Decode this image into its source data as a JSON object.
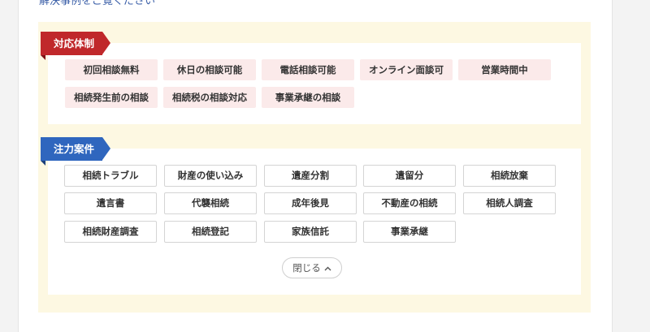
{
  "top_text": "解決事例をご覧ください",
  "support": {
    "title": "対応体制",
    "tags": [
      "初回相談無料",
      "休日の相談可能",
      "電話相談可能",
      "オンライン面談可",
      "営業時間中",
      "相続発生前の相談",
      "相続税の相談対応",
      "事業承継の相談"
    ]
  },
  "focus": {
    "title": "注力案件",
    "tags": [
      "相続トラブル",
      "財産の使い込み",
      "遺産分割",
      "遺留分",
      "相続放棄",
      "遺言書",
      "代襲相続",
      "成年後見",
      "不動産の相続",
      "相続人調査",
      "相続財産調査",
      "相続登記",
      "家族信託",
      "事業承継"
    ]
  },
  "toggle": {
    "label": "閉じる",
    "icon": "chevron-up-icon"
  },
  "colors": {
    "panel_bg": "#fdf8e2",
    "red_ribbon": "#c0282b",
    "blue_ribbon": "#2f66be",
    "pink_tag": "#fbeaea"
  }
}
